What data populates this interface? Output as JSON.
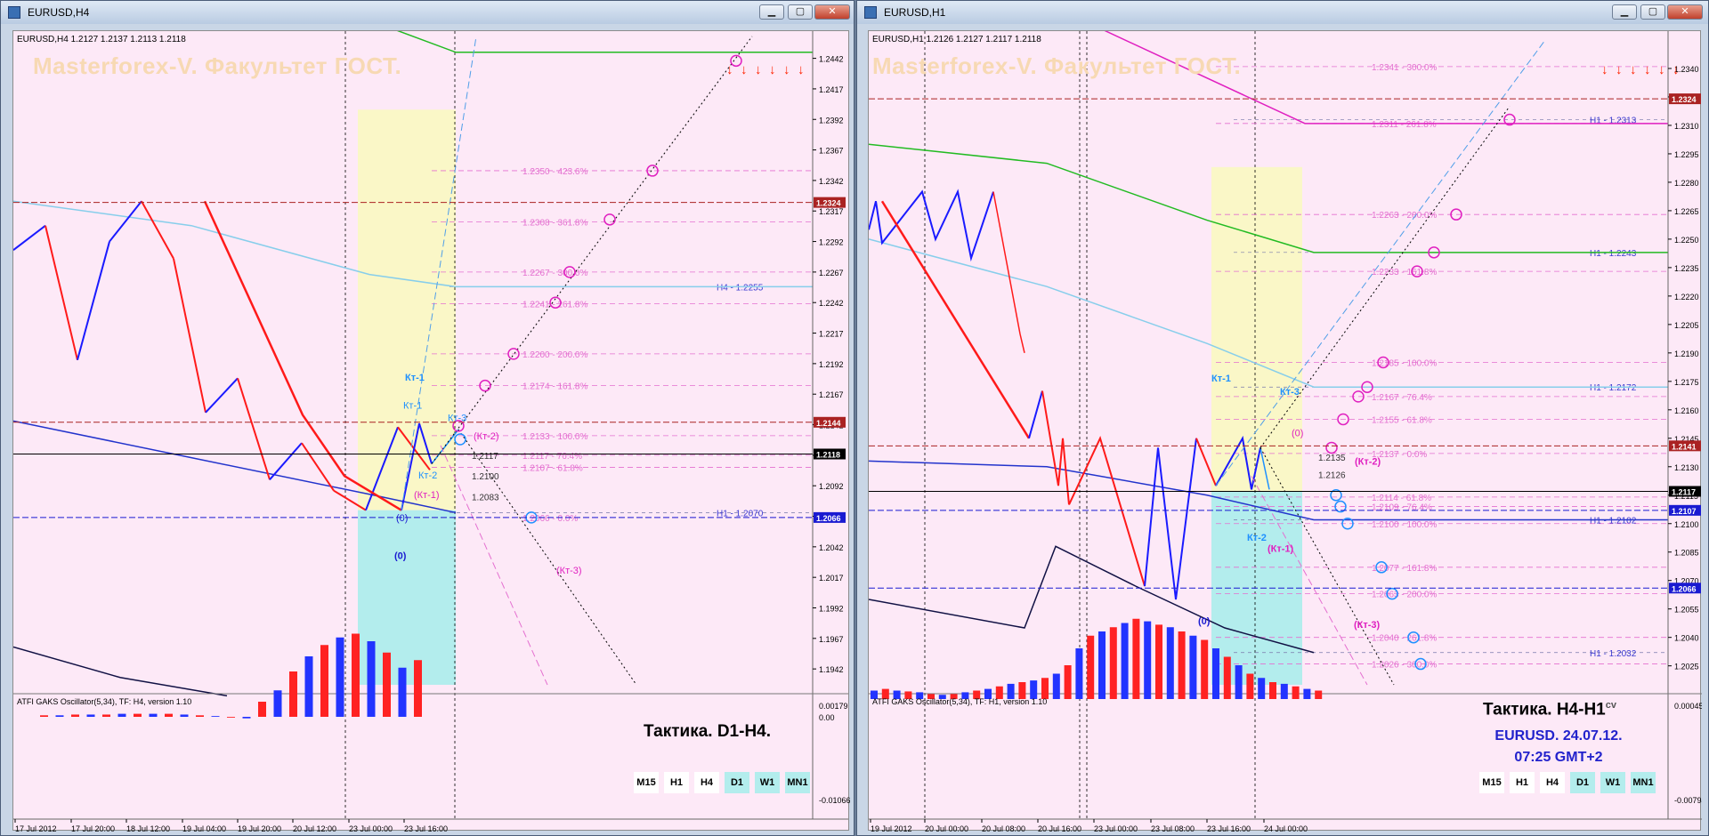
{
  "colors": {
    "chart_bg": "#fde9f7",
    "up_bar": "#1a1aff",
    "down_bar": "#ff1a1a",
    "yellow_zone": "#faf7c7",
    "cyan_zone": "#b3eded",
    "fib_pink": "#e46fd0",
    "current_price_bg": "#000000",
    "resistance_bg": "#aa2222",
    "support_bg": "#1a1ad1"
  },
  "left_window": {
    "title": "EURUSD,H4",
    "ohlc": "EURUSD,H4  1.2127 1.2137 1.2113 1.2118",
    "watermark": "Masterforex-V. Факультет ГОСТ.",
    "tactic": "Тактика. D1-H4.",
    "osc_label": "ATFI GAKS Oscillator(5,34), TF: H4, version 1.10",
    "osc_top": "0.00179",
    "osc_zero": "0.00",
    "osc_bottom": "-0.01066",
    "timeframes": [
      {
        "label": "M15",
        "highlight": false
      },
      {
        "label": "H1",
        "highlight": false
      },
      {
        "label": "H4",
        "highlight": false
      },
      {
        "label": "D1",
        "highlight": true
      },
      {
        "label": "W1",
        "highlight": true
      },
      {
        "label": "MN1",
        "highlight": true
      }
    ]
  },
  "right_window": {
    "title": "EURUSD,H1",
    "ohlc": "EURUSD,H1  1.2126 1.2127 1.2117 1.2118",
    "watermark": "Masterforex-V. Факультет ГОСТ.",
    "tactic": "Тактика. H4-H1",
    "tactic_suffix": "cv",
    "info_line1": "EURUSD. 24.07.12.",
    "info_line2": "07:25  GMT+2",
    "osc_label": "ATFI GAKS Oscillator(5,34), TF: H1, version 1.10",
    "osc_top": "0.00045",
    "osc_bottom": "-0.00794",
    "timeframes": [
      {
        "label": "M15",
        "highlight": false
      },
      {
        "label": "H1",
        "highlight": false
      },
      {
        "label": "H4",
        "highlight": false
      },
      {
        "label": "D1",
        "highlight": true
      },
      {
        "label": "W1",
        "highlight": true
      },
      {
        "label": "MN1",
        "highlight": true
      }
    ]
  },
  "chart_data": [
    {
      "type": "line",
      "title": "EURUSD,H4",
      "symbol": "EURUSD",
      "timeframe": "H4",
      "ylim": [
        1.1929,
        1.2457
      ],
      "y_ticks": [
        "1.2442",
        "1.2417",
        "1.2392",
        "1.2367",
        "1.2342",
        "1.2317",
        "1.2292",
        "1.2267",
        "1.2242",
        "1.2217",
        "1.2192",
        "1.2167",
        "1.2142",
        "1.2117",
        "1.2092",
        "1.2067",
        "1.2042",
        "1.2017",
        "1.1992",
        "1.1967",
        "1.1942"
      ],
      "x_ticks": [
        "17 Jul 2012",
        "17 Jul 20:00",
        "18 Jul 12:00",
        "19 Jul 04:00",
        "19 Jul 20:00",
        "20 Jul 12:00",
        "23 Jul 00:00",
        "23 Jul 16:00"
      ],
      "price_tags": [
        {
          "value": "1.2324",
          "role": "resistance"
        },
        {
          "value": "1.2144",
          "role": "resistance"
        },
        {
          "value": "1.2118",
          "role": "current"
        },
        {
          "value": "1.2066",
          "role": "support"
        }
      ],
      "zigzag": [
        {
          "x": 0,
          "y": 1.2285
        },
        {
          "x": 1,
          "y": 1.2305
        },
        {
          "x": 2,
          "y": 1.2195
        },
        {
          "x": 3,
          "y": 1.2292
        },
        {
          "x": 4,
          "y": 1.2325
        },
        {
          "x": 5,
          "y": 1.2278
        },
        {
          "x": 6,
          "y": 1.2152
        },
        {
          "x": 7,
          "y": 1.218
        },
        {
          "x": 8,
          "y": 1.2097
        },
        {
          "x": 9,
          "y": 1.2127
        },
        {
          "x": 10,
          "y": 1.2088
        },
        {
          "x": 11,
          "y": 1.2072
        },
        {
          "x": 12,
          "y": 1.214
        },
        {
          "x": 13,
          "y": 1.2105
        }
      ],
      "fib_levels": [
        {
          "label": "1.2350 - 423.6%",
          "value": 1.235
        },
        {
          "label": "1.2308 - 361.8%",
          "value": 1.2308
        },
        {
          "label": "1.2267 - 300.0%",
          "value": 1.2267
        },
        {
          "label": "1.2241 - 261.8%",
          "value": 1.2241
        },
        {
          "label": "1.2200 - 200.0%",
          "value": 1.22
        },
        {
          "label": "1.2174 - 161.8%",
          "value": 1.2174
        },
        {
          "label": "1.2133 - 100.0%",
          "value": 1.2133
        },
        {
          "label": "1.2117 - 76.4%",
          "value": 1.2117
        },
        {
          "label": "1.2107 - 61.8%",
          "value": 1.2107
        },
        {
          "label": "1.2066 - 0.0%",
          "value": 1.2066
        }
      ],
      "level_labels": [
        {
          "label": "H4 - 1.2255",
          "value": 1.2255
        },
        {
          "label": "H1 - 1.2070",
          "value": 1.207
        },
        {
          "label": "1.2117",
          "value": 1.2117
        },
        {
          "label": "1.2100",
          "value": 1.21
        },
        {
          "label": "1.2083",
          "value": 1.2083
        }
      ],
      "annotations": [
        "Кт-1",
        "Кт-1",
        "Кт-3",
        "Кт-2",
        "(Кт-2)",
        "(Кт-1)",
        "(Кт-3)",
        "(0)",
        "(0)"
      ]
    },
    {
      "type": "line",
      "title": "EURUSD,H1",
      "symbol": "EURUSD",
      "timeframe": "H1",
      "ylim": [
        1.2015,
        1.2355
      ],
      "y_ticks": [
        "1.2340",
        "1.2325",
        "1.2310",
        "1.2295",
        "1.2280",
        "1.2265",
        "1.2250",
        "1.2235",
        "1.2220",
        "1.2205",
        "1.2190",
        "1.2175",
        "1.2160",
        "1.2145",
        "1.2130",
        "1.2115",
        "1.2100",
        "1.2085",
        "1.2070",
        "1.2055",
        "1.2040",
        "1.2025"
      ],
      "x_ticks": [
        "19 Jul 2012",
        "20 Jul 00:00",
        "20 Jul 08:00",
        "20 Jul 16:00",
        "23 Jul 00:00",
        "23 Jul 08:00",
        "23 Jul 16:00",
        "24 Jul 00:00"
      ],
      "price_tags": [
        {
          "value": "1.2324",
          "role": "resistance"
        },
        {
          "value": "1.2141",
          "role": "resistance"
        },
        {
          "value": "1.2117",
          "role": "current"
        },
        {
          "value": "1.2107",
          "role": "support"
        },
        {
          "value": "1.2066",
          "role": "support"
        }
      ],
      "fib_levels": [
        {
          "label": "1.2341 - 300.0%",
          "value": 1.2341
        },
        {
          "label": "1.2311 - 261.8%",
          "value": 1.2311
        },
        {
          "label": "1.2263 - 200.0%",
          "value": 1.2263
        },
        {
          "label": "1.2233 - 161.8%",
          "value": 1.2233
        },
        {
          "label": "1.2185 - 100.0%",
          "value": 1.2185
        },
        {
          "label": "1.2167 - 76.4%",
          "value": 1.2167
        },
        {
          "label": "1.2155 - 61.8%",
          "value": 1.2155
        },
        {
          "label": "1.2137 - 0.0%",
          "value": 1.2137
        },
        {
          "label": "1.2114 - 61.8%",
          "value": 1.2114
        },
        {
          "label": "1.2109 - 76.4%",
          "value": 1.2109
        },
        {
          "label": "1.2100 - 100.0%",
          "value": 1.21
        },
        {
          "label": "1.2077 - 161.8%",
          "value": 1.2077
        },
        {
          "label": "1.2063 - 200.0%",
          "value": 1.2063
        },
        {
          "label": "1.2040 - 261.8%",
          "value": 1.204
        },
        {
          "label": "1.2026 - 300.0%",
          "value": 1.2026
        }
      ],
      "level_labels": [
        {
          "label": "H1 - 1.2313",
          "value": 1.2313
        },
        {
          "label": "H1 - 1.2243",
          "value": 1.2243
        },
        {
          "label": "H1 - 1.2172",
          "value": 1.2172
        },
        {
          "label": "H1 - 1.2102",
          "value": 1.2102
        },
        {
          "label": "H1 - 1.2032",
          "value": 1.2032
        },
        {
          "label": "1.2135",
          "value": 1.2135
        },
        {
          "label": "1.2126",
          "value": 1.2126
        }
      ],
      "annotations": [
        "Кт-1",
        "Кт-3",
        "(0)",
        "Кт-2",
        "(Кт-2)",
        "(Кт-1)",
        "(Кт-3)",
        "(0)"
      ]
    }
  ]
}
